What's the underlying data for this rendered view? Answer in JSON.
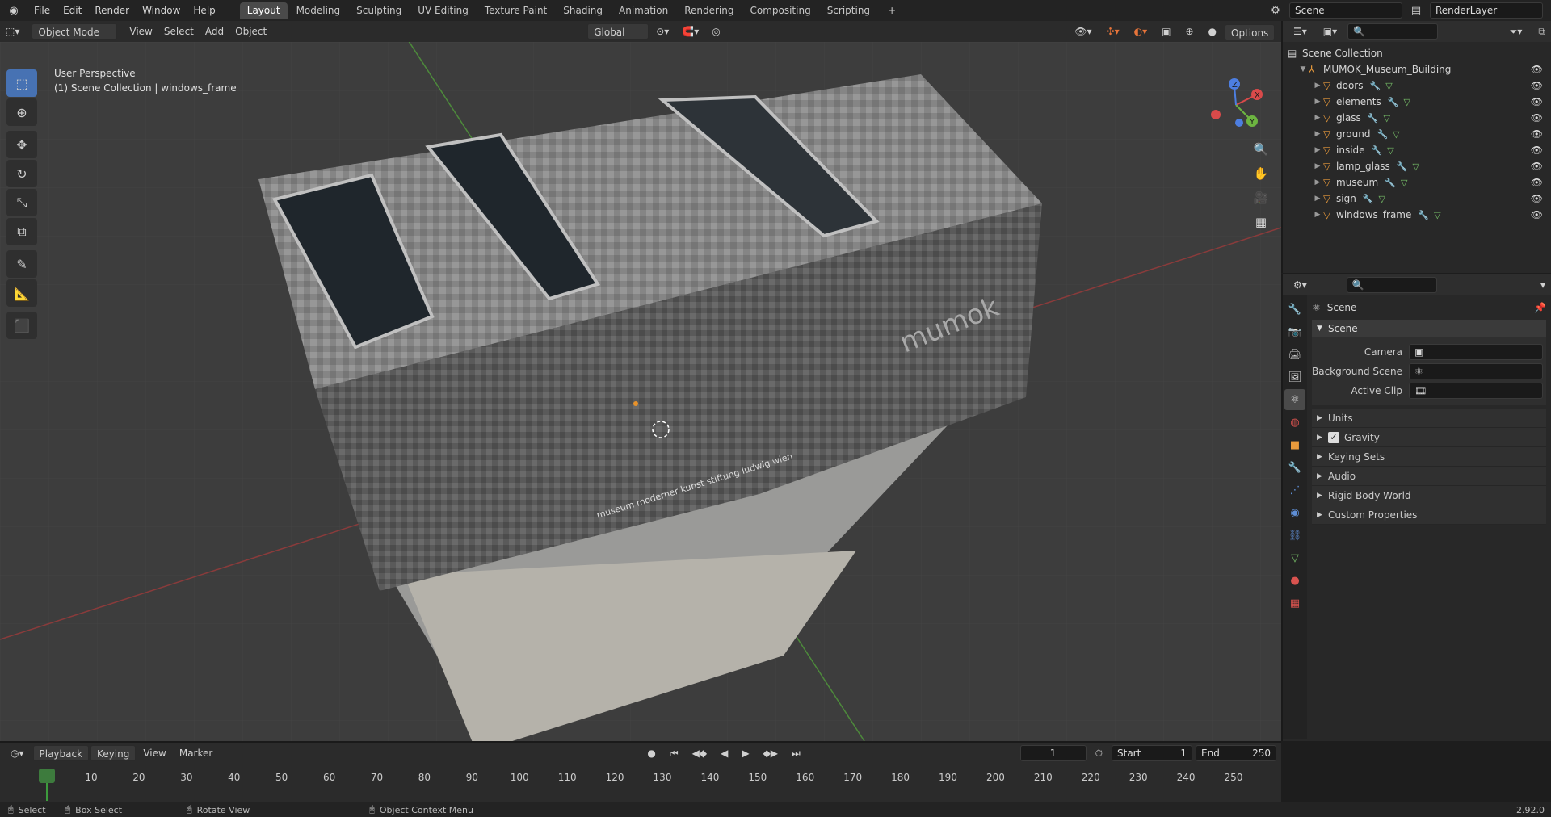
{
  "topbar": {
    "app_icon": "blender-icon",
    "menus": [
      "File",
      "Edit",
      "Render",
      "Window",
      "Help"
    ],
    "workspaces": [
      "Layout",
      "Modeling",
      "Sculpting",
      "UV Editing",
      "Texture Paint",
      "Shading",
      "Animation",
      "Rendering",
      "Compositing",
      "Scripting"
    ],
    "active_workspace": "Layout",
    "add_tab": "+",
    "scene_name": "Scene",
    "view_layer": "RenderLayer"
  },
  "viewport_header": {
    "mode": "Object Mode",
    "menus": [
      "View",
      "Select",
      "Add",
      "Object"
    ],
    "orientation": "Global",
    "options": "Options"
  },
  "viewport": {
    "perspective": "User Perspective",
    "collection_info": "(1) Scene Collection | windows_frame",
    "sign_text": "mumok",
    "facade_text": "museum moderner kunst stiftung ludwig wien"
  },
  "gizmo": {
    "x": "X",
    "y": "Y",
    "z": "Z"
  },
  "outliner": {
    "root": "Scene Collection",
    "collection": "MUMOK_Museum_Building",
    "objects": [
      "doors",
      "elements",
      "glass",
      "ground",
      "inside",
      "lamp_glass",
      "museum",
      "sign",
      "windows_frame"
    ]
  },
  "properties": {
    "header": "Scene",
    "panel": "Scene",
    "camera_label": "Camera",
    "background_label": "Background Scene",
    "clip_label": "Active Clip",
    "subpanels": [
      "Units",
      "Gravity",
      "Keying Sets",
      "Audio",
      "Rigid Body World",
      "Custom Properties"
    ],
    "gravity_checked": true
  },
  "timeline": {
    "menus": [
      "Playback",
      "Keying",
      "View",
      "Marker"
    ],
    "current_frame": "1",
    "start_label": "Start",
    "start": "1",
    "end_label": "End",
    "end": "250",
    "ticks": [
      "1",
      "10",
      "20",
      "30",
      "40",
      "50",
      "60",
      "70",
      "80",
      "90",
      "100",
      "110",
      "120",
      "130",
      "140",
      "150",
      "160",
      "170",
      "180",
      "190",
      "200",
      "210",
      "220",
      "230",
      "240",
      "250"
    ]
  },
  "statusbar": {
    "select": "Select",
    "box_select": "Box Select",
    "rotate": "Rotate View",
    "context_menu": "Object Context Menu",
    "version": "2.92.0"
  }
}
